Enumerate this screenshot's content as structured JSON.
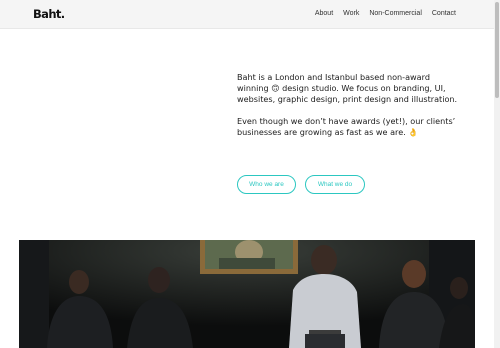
{
  "brand": {
    "logo_text": "Baht."
  },
  "nav": {
    "items": [
      {
        "label": "About"
      },
      {
        "label": "Work"
      },
      {
        "label": "Non-Commercial"
      },
      {
        "label": "Contact"
      }
    ]
  },
  "intro": {
    "paragraph1_before_emoji": "Baht is a London and Istanbul based non-award winning ",
    "emoji1": "🙃",
    "paragraph1_after_emoji": " design studio. We focus on branding, UI, websites, graphic design, print design and illustration.",
    "paragraph2_before_emoji": "Even though we don’t have awards (yet!), our clients’ businesses are growing as fast as we are. ",
    "emoji2": "👌"
  },
  "buttons": {
    "who_label": "Who we are",
    "what_label": "What we do"
  },
  "colors": {
    "accent": "#2cc7c1",
    "header_bg": "#f5f5f5",
    "text": "#1c1c1c"
  },
  "hero_image": {
    "icon": "museum-gallery-photo"
  }
}
